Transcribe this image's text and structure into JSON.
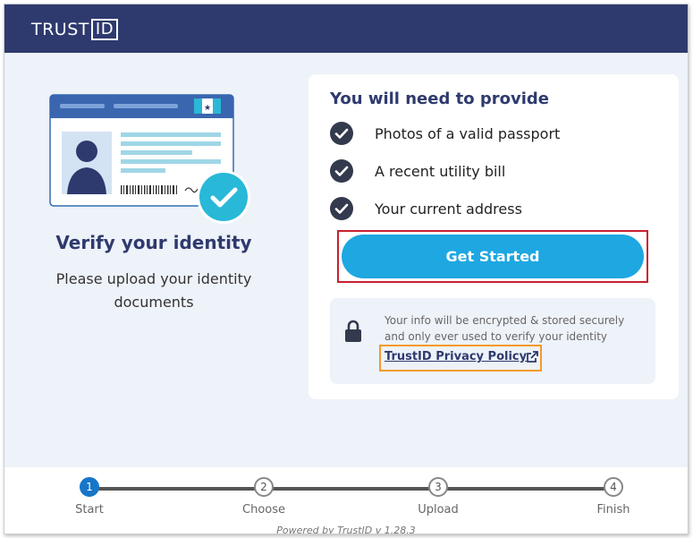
{
  "app": {
    "logo_text": "TRUST",
    "logo_box": "ID"
  },
  "left": {
    "title": "Verify your identity",
    "subtitle": "Please upload your identity documents"
  },
  "requirements": {
    "heading": "You will need to provide",
    "items": [
      "Photos of a valid passport",
      "A recent utility bill",
      "Your current address"
    ]
  },
  "cta": {
    "label": "Get Started"
  },
  "privacy": {
    "message": "Your info will be encrypted & stored securely and only ever used to verify your identity",
    "link_label": "TrustID Privacy Policy"
  },
  "steps": [
    {
      "number": "1",
      "label": "Start",
      "active": true
    },
    {
      "number": "2",
      "label": "Choose",
      "active": false
    },
    {
      "number": "3",
      "label": "Upload",
      "active": false
    },
    {
      "number": "4",
      "label": "Finish",
      "active": false
    }
  ],
  "footer": {
    "powered": "Powered by TrustID v 1.28.3"
  },
  "colors": {
    "brand_navy": "#2e3a6e",
    "accent_blue": "#1ea7e1",
    "step_active": "#1676c8",
    "check_teal": "#28b8d8",
    "highlight_red": "#c8202f",
    "highlight_orange": "#f59a2a"
  }
}
